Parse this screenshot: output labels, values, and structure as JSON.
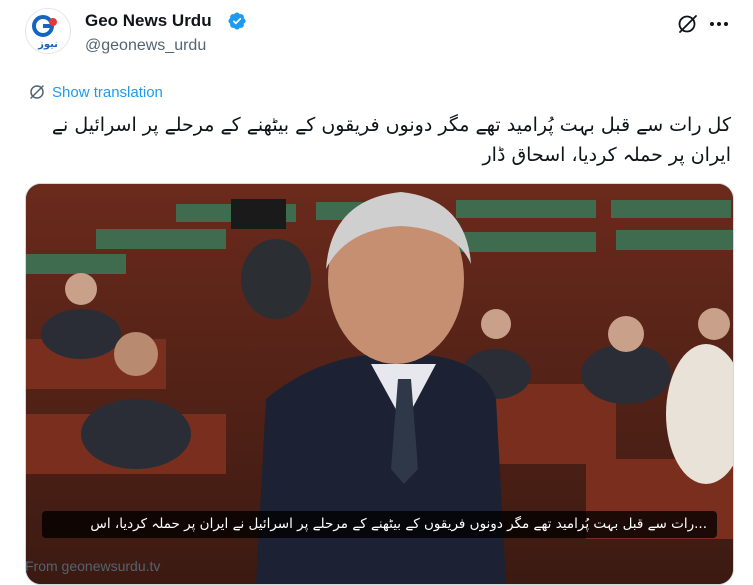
{
  "header": {
    "display_name": "Geo News Urdu",
    "handle": "@geonews_urdu",
    "verified": true,
    "avatar_logo_text": "نیوز",
    "avatar_logo_mark": "geo"
  },
  "top_icons": [
    "grok-icon",
    "more-options-icon"
  ],
  "translation": {
    "label": "Show translation",
    "icon": "translate-icon"
  },
  "tweet": {
    "text": "کل رات سے قبل بہت پُرامید تھے مگر دونوں فریقوں کے بیٹھنے کے مرحلے پر اسرائیل نے ایران پر حملہ کردیا، اسحاق ڈار"
  },
  "media": {
    "caption": "...رات سے قبل بہت پُرامید تھے مگر دونوں فریقوں کے بیٹھنے کے مرحلے پر اسرائیل نے ایران پر حملہ کردیا، اس",
    "source": "From geonewsurdu.tv"
  },
  "colors": {
    "accent": "#1d9bf0",
    "text_primary": "#0f1419",
    "text_secondary": "#536471",
    "geo_blue": "#1565c0",
    "geo_red": "#e53935"
  }
}
